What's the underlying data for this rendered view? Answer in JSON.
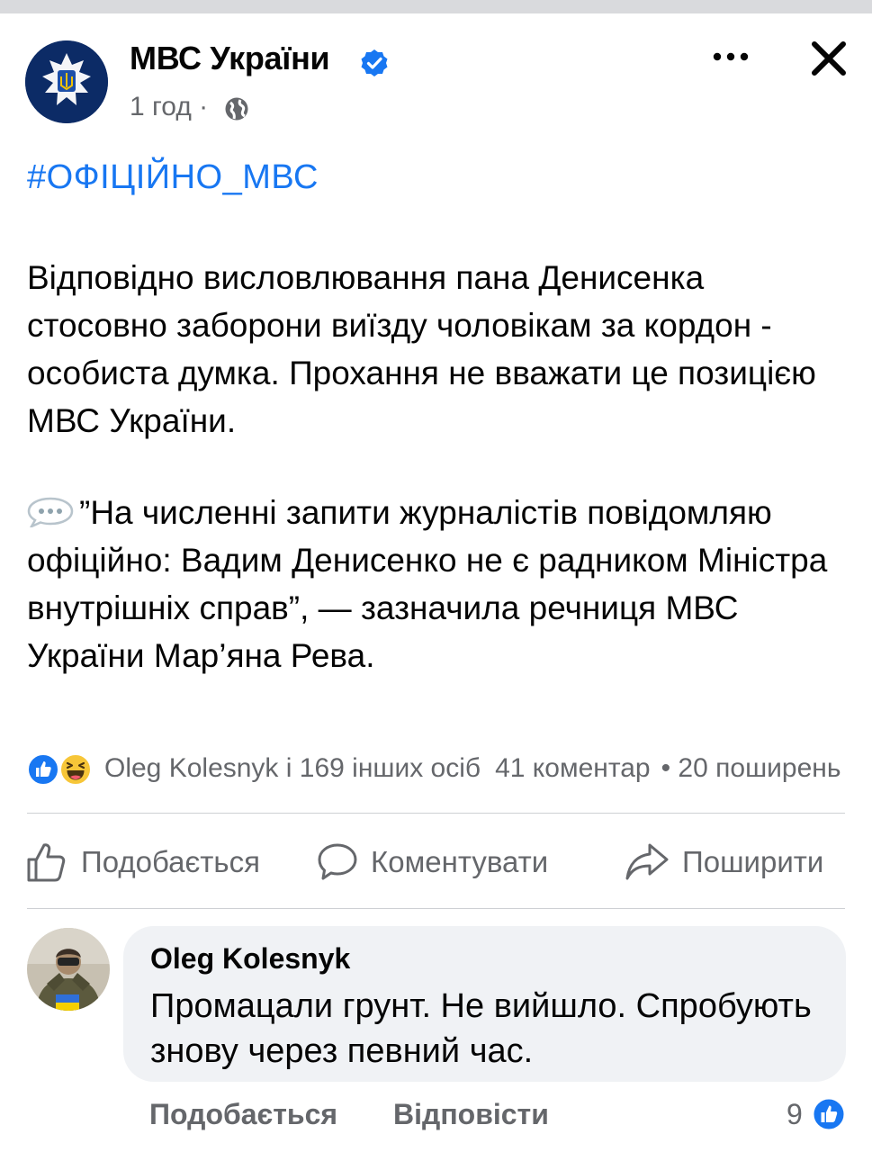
{
  "post": {
    "page_name": "МВС України",
    "time": "1 год ·",
    "hashtag": "#ОФІЦІЙНО_МВС",
    "paragraph1": "Відповідно висловлювання пана Денисенка стосовно заборони виїзду чоловікам за кордон - особиста думка. Прохання не вважати це позицією МВС України.",
    "paragraph2": "”На численні запити журналістів повідомляю офіційно: Вадим Денисенко не є радником Міністра внутрішніх справ”, — зазначила речниця МВС України Мар’яна Рева."
  },
  "reactions": {
    "text": "Oleg Kolesnyk і 169 інших осіб",
    "comments": "41 коментар",
    "shares": "• 20 поширень"
  },
  "actions": {
    "like": "Подобається",
    "comment": "Коментувати",
    "share": "Поширити"
  },
  "comment": {
    "author": "Oleg Kolesnyk",
    "text": "Промацали грунт. Не вийшло. Спробують знову через певний час.",
    "like_label": "Подобається",
    "reply_label": "Відповісти",
    "like_count": "9"
  },
  "colors": {
    "accent": "#1877f2",
    "secondary_text": "#65676b",
    "bubble": "#f0f2f5"
  },
  "icons": [
    "police-emblem-icon",
    "verified-badge-icon",
    "globe-icon",
    "more-options-icon",
    "close-icon",
    "speech-bubble-emoji-icon",
    "like-reaction-icon",
    "haha-reaction-icon",
    "thumbs-up-icon",
    "comment-icon",
    "share-icon"
  ]
}
